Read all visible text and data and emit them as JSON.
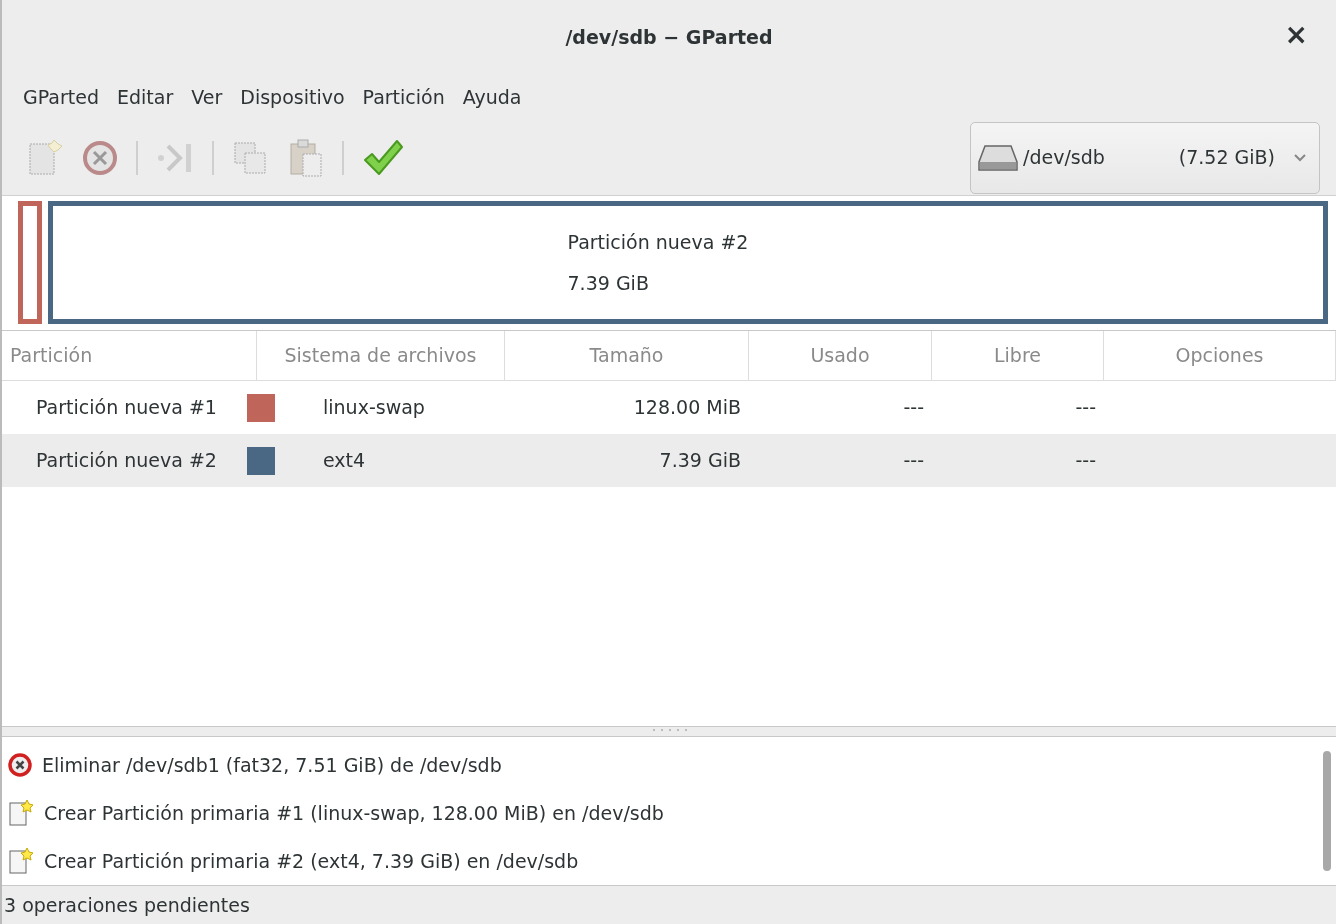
{
  "window": {
    "title": "/dev/sdb − GParted",
    "close": "×"
  },
  "menu": [
    "GParted",
    "Editar",
    "Ver",
    "Dispositivo",
    "Partición",
    "Ayuda"
  ],
  "toolbar": [
    {
      "kind": "new",
      "disabled": true
    },
    {
      "kind": "delete",
      "disabled": true
    },
    {
      "kind": "separator"
    },
    {
      "kind": "resize",
      "disabled": true
    },
    {
      "kind": "separator"
    },
    {
      "kind": "copy",
      "disabled": true
    },
    {
      "kind": "paste",
      "disabled": true
    },
    {
      "kind": "separator"
    },
    {
      "kind": "apply",
      "disabled": false
    }
  ],
  "device": {
    "name": "/dev/sdb",
    "size": "(7.52 GiB)"
  },
  "partition_map": [
    {
      "color": "#c0655a"
    },
    {
      "color": "#4a6883",
      "label": "Partición nueva #2",
      "size": "7.39 GiB"
    }
  ],
  "table": {
    "columns": [
      "Partición",
      "Sistema de archivos",
      "Tamaño",
      "Usado",
      "Libre",
      "Opciones"
    ],
    "rows": [
      {
        "partition": "Partición nueva #1",
        "color": "#c0655a",
        "filesystem": "linux-swap",
        "size": "128.00 MiB",
        "used": "---",
        "free": "---"
      },
      {
        "partition": "Partición nueva #2",
        "color": "#4a6883",
        "filesystem": "ext4",
        "size": "7.39 GiB",
        "used": "---",
        "free": "---"
      }
    ]
  },
  "operations": [
    {
      "kind": "delete",
      "text": "Eliminar /dev/sdb1 (fat32, 7.51 GiB) de /dev/sdb"
    },
    {
      "kind": "create",
      "text": "Crear Partición primaria #1 (linux-swap, 128.00 MiB) en /dev/sdb"
    },
    {
      "kind": "create",
      "text": "Crear Partición primaria #2 (ext4, 7.39 GiB) en /dev/sdb"
    }
  ],
  "status_bar": "3 operaciones pendientes"
}
